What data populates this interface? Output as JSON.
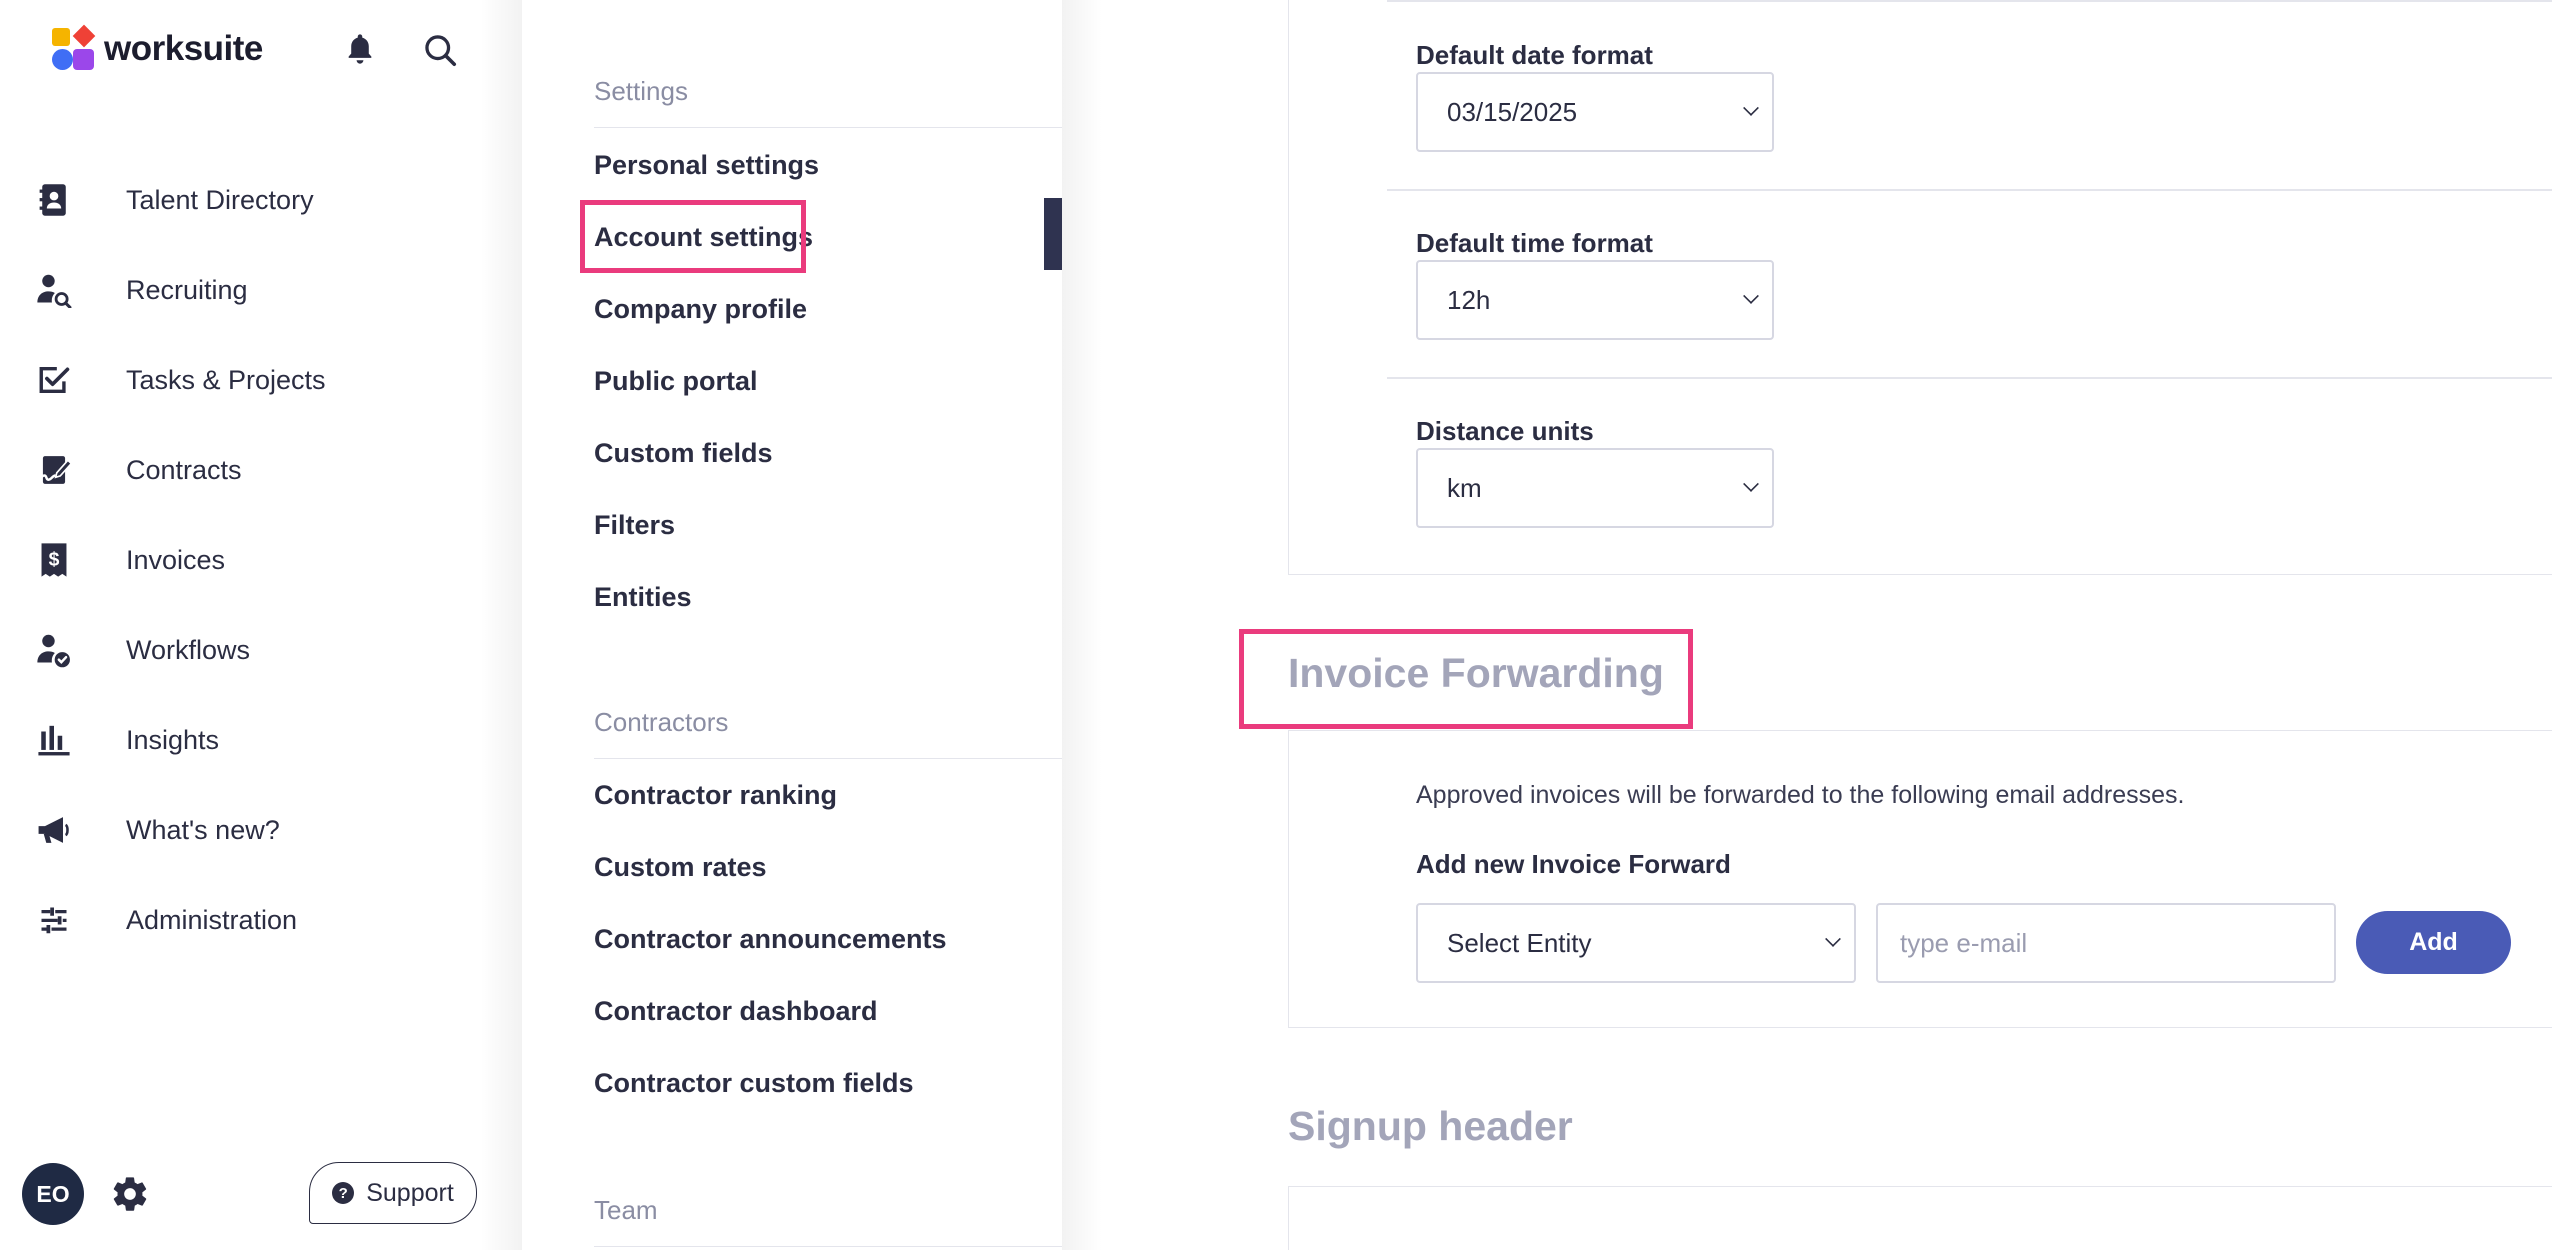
{
  "app": {
    "brand": "worksuite"
  },
  "nav": {
    "items": [
      {
        "label": "Talent Directory",
        "icon": "contact-book-icon"
      },
      {
        "label": "Recruiting",
        "icon": "person-search-icon"
      },
      {
        "label": "Tasks & Projects",
        "icon": "checkbox-icon"
      },
      {
        "label": "Contracts",
        "icon": "contract-sign-icon"
      },
      {
        "label": "Invoices",
        "icon": "dollar-document-icon"
      },
      {
        "label": "Workflows",
        "icon": "person-check-icon"
      },
      {
        "label": "Insights",
        "icon": "bar-chart-icon"
      },
      {
        "label": "What's new?",
        "icon": "megaphone-icon"
      },
      {
        "label": "Administration",
        "icon": "sliders-icon"
      }
    ],
    "user_initials": "EO",
    "support_label": "Support"
  },
  "submenu": {
    "settings_heading": "Settings",
    "settings_items": [
      "Personal settings",
      "Account settings",
      "Company profile",
      "Public portal",
      "Custom fields",
      "Filters",
      "Entities"
    ],
    "active_item": "Account settings",
    "contractors_heading": "Contractors",
    "contractors_items": [
      "Contractor ranking",
      "Custom rates",
      "Contractor announcements",
      "Contractor dashboard",
      "Contractor custom fields"
    ],
    "team_heading": "Team"
  },
  "main": {
    "date_format": {
      "label": "Default date format",
      "value": "03/15/2025"
    },
    "time_format": {
      "label": "Default time format",
      "value": "12h"
    },
    "distance_units": {
      "label": "Distance units",
      "value": "km"
    },
    "invoice_forwarding": {
      "title": "Invoice Forwarding",
      "description": "Approved invoices will be forwarded to the following email addresses.",
      "add_label": "Add new Invoice Forward",
      "entity_select": "Select Entity",
      "email_placeholder": "type e-mail",
      "add_button": "Add"
    },
    "signup_header": {
      "title": "Signup header"
    }
  },
  "colors": {
    "highlight": "#ea3b7d",
    "primary_button": "#4a5bb6",
    "active_indicator": "#2f3350",
    "avatar_bg": "#1f2a44"
  }
}
